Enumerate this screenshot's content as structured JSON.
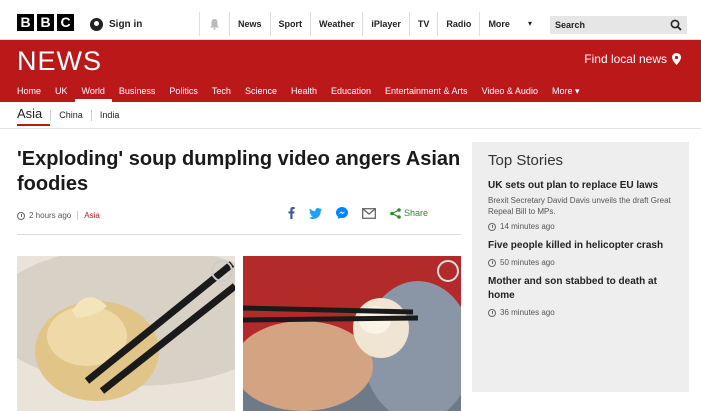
{
  "topbar": {
    "logo_letters": [
      "B",
      "B",
      "C"
    ],
    "sign_in": "Sign in",
    "nav": [
      "News",
      "Sport",
      "Weather",
      "iPlayer",
      "TV",
      "Radio",
      "More"
    ],
    "search_placeholder": "Search"
  },
  "header": {
    "title": "NEWS",
    "find_local": "Find local news",
    "brand_color": "#bb1919"
  },
  "main_nav": [
    {
      "label": "Home"
    },
    {
      "label": "UK"
    },
    {
      "label": "World",
      "active": true
    },
    {
      "label": "Business"
    },
    {
      "label": "Politics"
    },
    {
      "label": "Tech"
    },
    {
      "label": "Science"
    },
    {
      "label": "Health"
    },
    {
      "label": "Education"
    },
    {
      "label": "Entertainment & Arts"
    },
    {
      "label": "Video & Audio"
    },
    {
      "label": "More"
    }
  ],
  "sub_nav": {
    "active": "Asia",
    "items": [
      "China",
      "India"
    ]
  },
  "article": {
    "headline": "'Exploding' soup dumpling video angers Asian foodies",
    "time": "2 hours ago",
    "tag": "Asia",
    "share_label": "Share",
    "share_icons": [
      "facebook-icon",
      "twitter-icon",
      "messenger-icon",
      "email-icon",
      "share-icon"
    ]
  },
  "sidebar": {
    "title": "Top Stories",
    "stories": [
      {
        "title": "UK sets out plan to replace EU laws",
        "summary": "Brexit Secretary David Davis unveils the draft Great Repeal Bill to MPs.",
        "time": "14 minutes ago"
      },
      {
        "title": "Five people killed in helicopter crash",
        "summary": "",
        "time": "50 minutes ago"
      },
      {
        "title": "Mother and son stabbed to death at home",
        "summary": "",
        "time": "36 minutes ago"
      }
    ]
  }
}
